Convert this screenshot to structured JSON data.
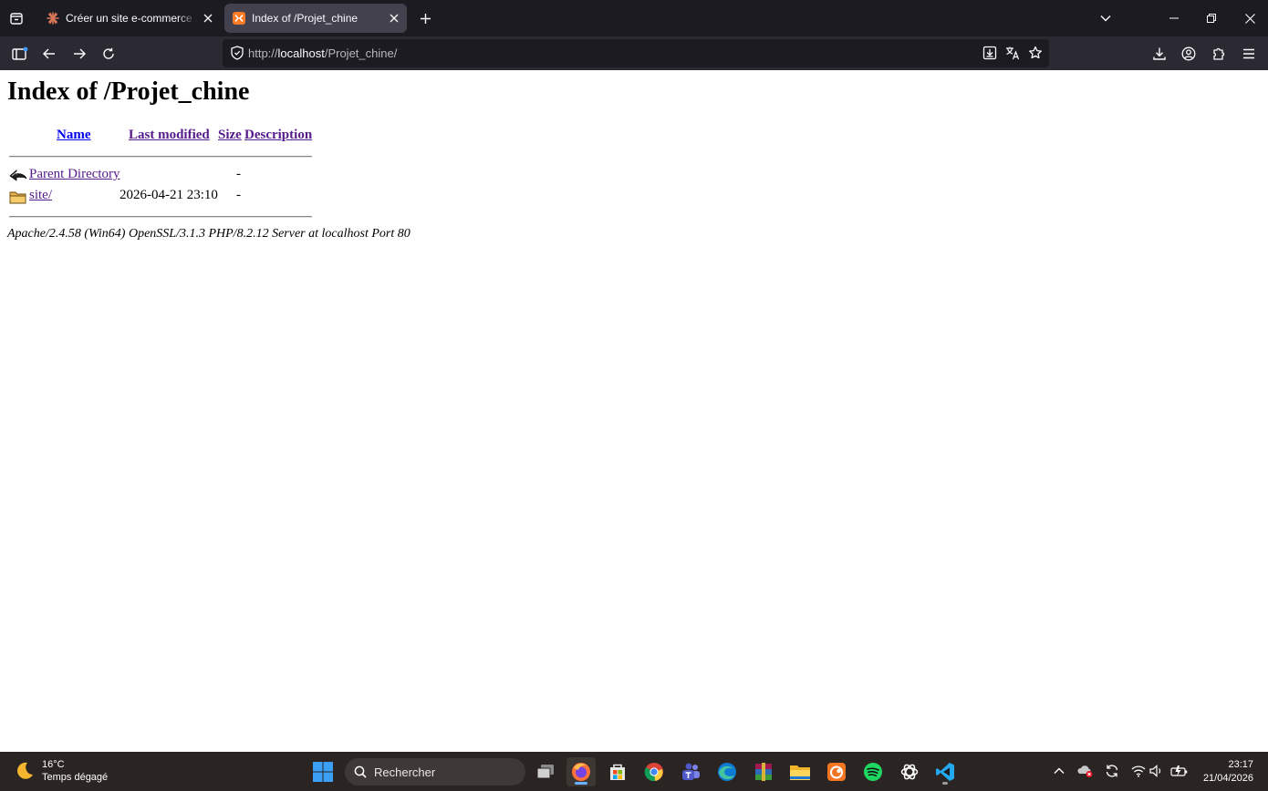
{
  "browser": {
    "tabs": [
      {
        "title": "Créer un site e-commerce avec",
        "active": false
      },
      {
        "title": "Index of /Projet_chine",
        "active": true
      }
    ],
    "url": {
      "scheme": "http://",
      "host": "localhost",
      "path": "/Projet_chine/"
    }
  },
  "page": {
    "heading": "Index of /Projet_chine",
    "columns": [
      "Name",
      "Last modified",
      "Size",
      "Description"
    ],
    "rows": [
      {
        "name": "Parent Directory",
        "modified": "",
        "size": "-",
        "description": "",
        "icon": "back-icon"
      },
      {
        "name": "site/",
        "modified": "2026-04-21 23:10",
        "size": "-",
        "description": "",
        "icon": "folder-icon"
      }
    ],
    "footer": "Apache/2.4.58 (Win64) OpenSSL/3.1.3 PHP/8.2.12 Server at localhost Port 80"
  },
  "taskbar": {
    "weather": {
      "temp": "16°C",
      "condition": "Temps dégagé"
    },
    "search_placeholder": "Rechercher",
    "clock": {
      "time": "23:17",
      "date": "21/04/2026"
    }
  },
  "colors": {
    "tab_bg": "#1c1b22",
    "nav_bg": "#2b2a33",
    "taskbar_bg": "#2a2523",
    "link_visited": "#551a8b",
    "link": "#0000ee"
  }
}
